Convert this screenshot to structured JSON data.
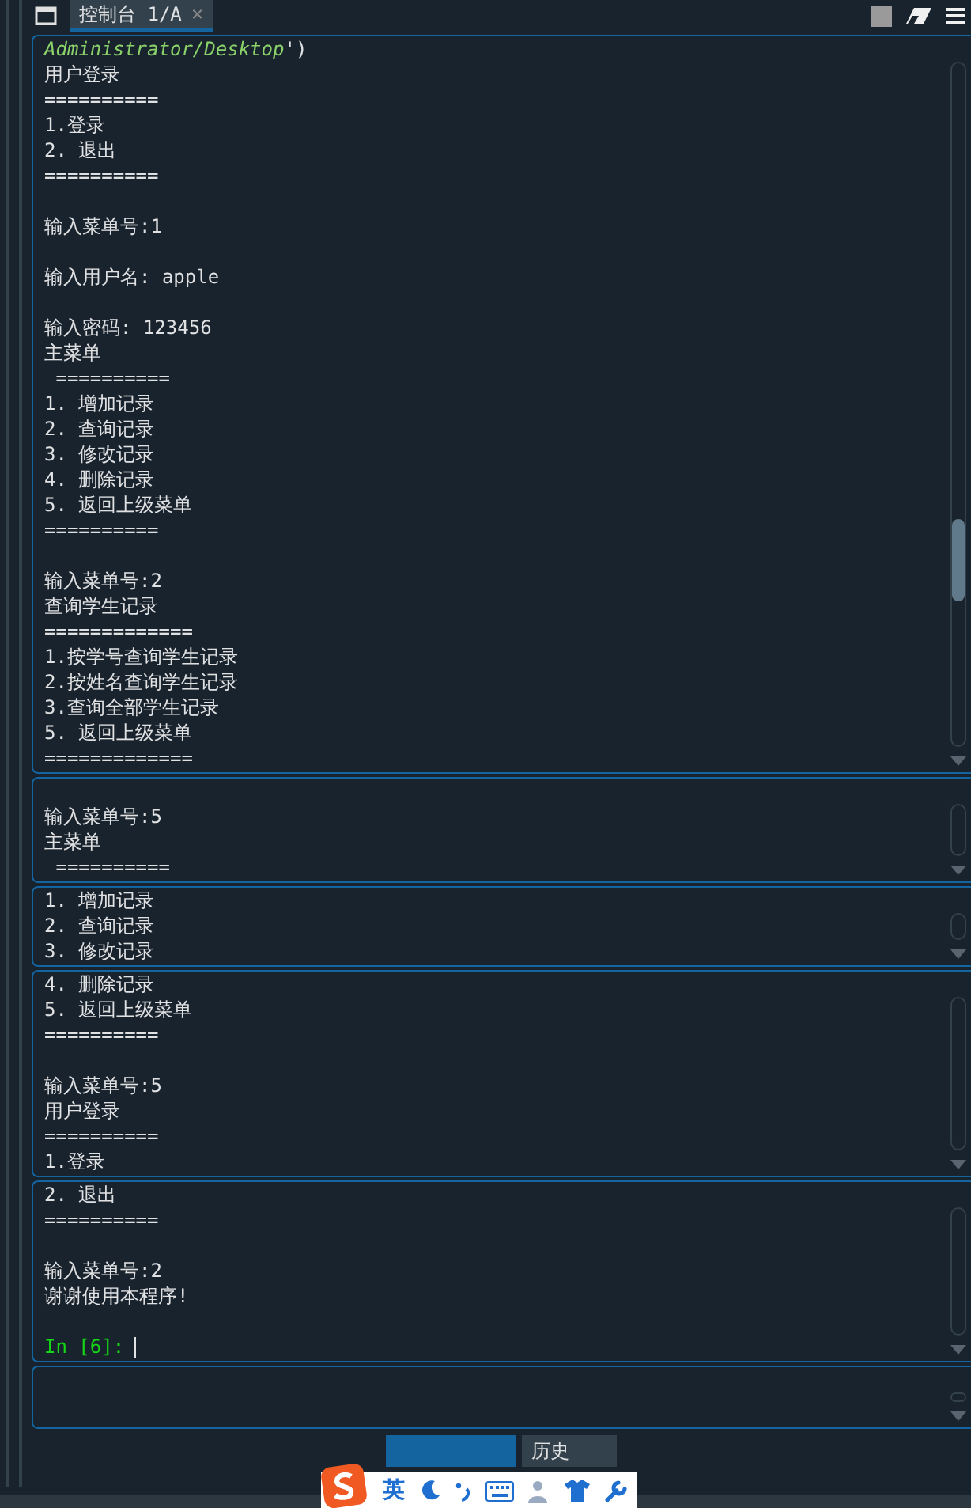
{
  "tab": {
    "label": "控制台 1/A",
    "close": "×",
    "selected": true
  },
  "panels": [
    {
      "lines": [
        {
          "kind": "path",
          "text": "Administrator/Desktop",
          "suffix": "')"
        },
        {
          "kind": "out",
          "text": "用户登录"
        },
        {
          "kind": "out",
          "text": "=========="
        },
        {
          "kind": "out",
          "text": "1.登录"
        },
        {
          "kind": "out",
          "text": "2. 退出"
        },
        {
          "kind": "out",
          "text": "=========="
        },
        {
          "kind": "blank"
        },
        {
          "kind": "out",
          "text": "输入菜单号:1"
        },
        {
          "kind": "blank"
        },
        {
          "kind": "out",
          "text": "输入用户名: apple"
        },
        {
          "kind": "blank"
        },
        {
          "kind": "out",
          "text": "输入密码: 123456"
        },
        {
          "kind": "out",
          "text": "主菜单"
        },
        {
          "kind": "out",
          "text": " =========="
        },
        {
          "kind": "out",
          "text": "1. 增加记录"
        },
        {
          "kind": "out",
          "text": "2. 查询记录"
        },
        {
          "kind": "out",
          "text": "3. 修改记录"
        },
        {
          "kind": "out",
          "text": "4. 删除记录"
        },
        {
          "kind": "out",
          "text": "5. 返回上级菜单"
        },
        {
          "kind": "out",
          "text": "=========="
        },
        {
          "kind": "blank"
        },
        {
          "kind": "out",
          "text": "输入菜单号:2"
        },
        {
          "kind": "out",
          "text": "查询学生记录"
        },
        {
          "kind": "out",
          "text": "============="
        },
        {
          "kind": "out",
          "text": "1.按学号查询学生记录"
        },
        {
          "kind": "out",
          "text": "2.按姓名查询学生记录"
        },
        {
          "kind": "out",
          "text": "3.查询全部学生记录"
        },
        {
          "kind": "out",
          "text": "5. 返回上级菜单"
        },
        {
          "kind": "out",
          "text": "============="
        }
      ]
    },
    {
      "lines": [
        {
          "kind": "blank"
        },
        {
          "kind": "out",
          "text": "输入菜单号:5"
        },
        {
          "kind": "out",
          "text": "主菜单"
        },
        {
          "kind": "out",
          "text": " =========="
        }
      ]
    },
    {
      "lines": [
        {
          "kind": "out",
          "text": "1. 增加记录"
        },
        {
          "kind": "out",
          "text": "2. 查询记录"
        },
        {
          "kind": "out",
          "text": "3. 修改记录"
        }
      ]
    },
    {
      "lines": [
        {
          "kind": "out",
          "text": "4. 删除记录"
        },
        {
          "kind": "out",
          "text": "5. 返回上级菜单"
        },
        {
          "kind": "out",
          "text": "=========="
        },
        {
          "kind": "blank"
        },
        {
          "kind": "out",
          "text": "输入菜单号:5"
        },
        {
          "kind": "out",
          "text": "用户登录"
        },
        {
          "kind": "out",
          "text": "=========="
        },
        {
          "kind": "out",
          "text": "1.登录"
        }
      ]
    },
    {
      "lines": [
        {
          "kind": "out",
          "text": "2. 退出"
        },
        {
          "kind": "out",
          "text": "=========="
        },
        {
          "kind": "blank"
        },
        {
          "kind": "out",
          "text": "输入菜单号:2"
        },
        {
          "kind": "out",
          "text": "谢谢使用本程序!"
        },
        {
          "kind": "blank"
        },
        {
          "kind": "prompt",
          "text": "In [6]:"
        }
      ]
    },
    {
      "kind": "empty"
    }
  ],
  "bottom_tabs": [
    {
      "selected": true
    },
    {
      "label": "历史",
      "selected": false
    }
  ],
  "ime": {
    "label": "英"
  }
}
